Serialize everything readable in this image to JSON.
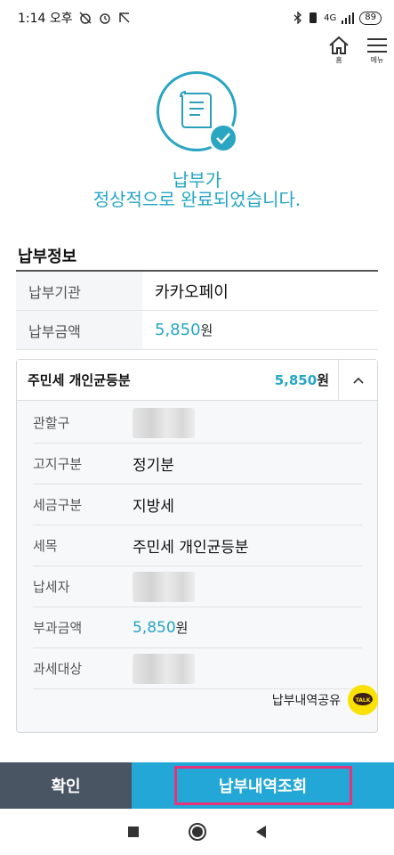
{
  "status_bar": {
    "time": "1:14 오후",
    "network": "4G",
    "battery": "89"
  },
  "header": {
    "home_label": "홈",
    "menu_label": "메뉴"
  },
  "hero": {
    "line1": "납부가",
    "line2": "정상적으로 완료되었습니다."
  },
  "payment_info": {
    "title": "납부정보",
    "rows": [
      {
        "label": "납부기관",
        "value": "카카오페이"
      },
      {
        "label": "납부금액",
        "amount": "5,850",
        "unit": "원"
      }
    ]
  },
  "detail": {
    "title": "주민세 개인균등분",
    "amount": "5,850",
    "unit": "원",
    "rows": [
      {
        "label": "관할구",
        "value": ""
      },
      {
        "label": "고지구분",
        "value": "정기분"
      },
      {
        "label": "세금구분",
        "value": "지방세"
      },
      {
        "label": "세목",
        "value": "주민세 개인균등분"
      },
      {
        "label": "납세자",
        "value": ""
      },
      {
        "label": "부과금액",
        "amount": "5,850",
        "unit": "원"
      },
      {
        "label": "과세대상",
        "value": ""
      }
    ],
    "share_label": "납부내역공유",
    "talk_badge": "TALK"
  },
  "buttons": {
    "confirm": "확인",
    "history": "납부내역조회"
  },
  "colors": {
    "accent": "#25a6c2",
    "confirm_bg": "#4a5563",
    "history_bg": "#22a7d6",
    "highlight": "#e8337a",
    "kakao": "#fae100"
  }
}
